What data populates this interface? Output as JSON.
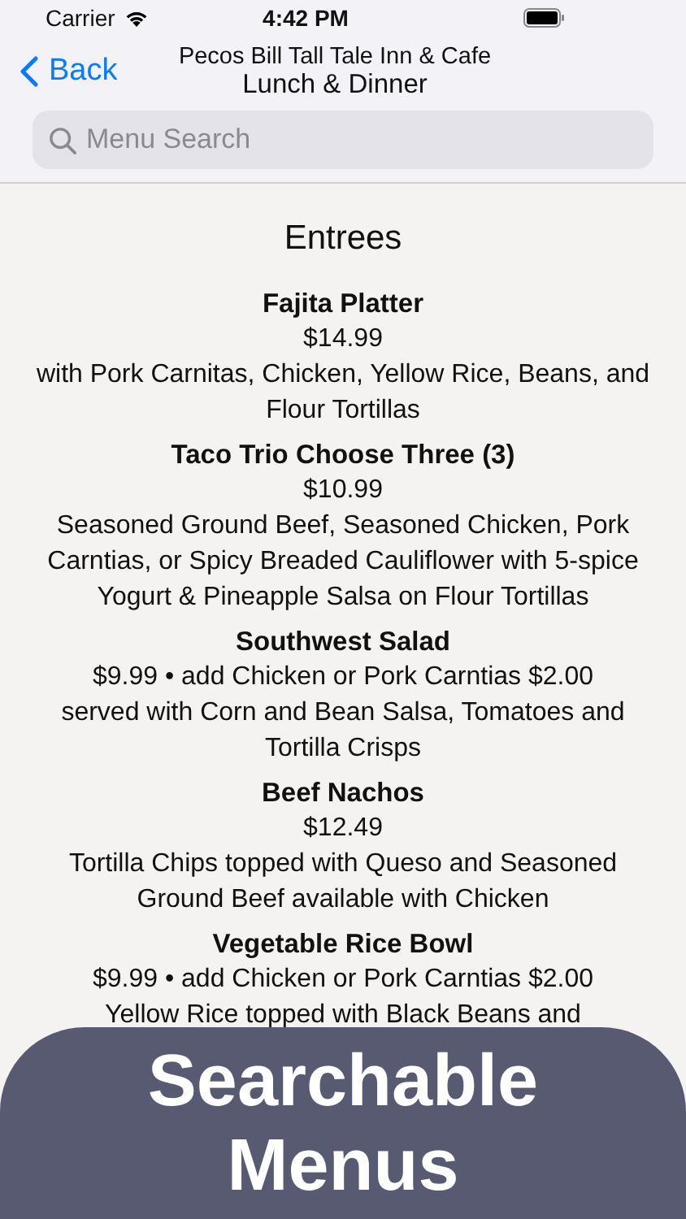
{
  "status_bar": {
    "carrier": "Carrier",
    "time": "4:42 PM"
  },
  "nav": {
    "back": "Back",
    "title": "Pecos Bill Tall Tale Inn & Cafe",
    "subtitle": "Lunch & Dinner"
  },
  "search": {
    "placeholder": "Menu Search"
  },
  "section": {
    "title": "Entrees",
    "items": [
      {
        "name": "Fajita Platter",
        "price": "$14.99",
        "description": "with Pork Carnitas, Chicken, Yellow Rice, Beans, and Flour Tortillas"
      },
      {
        "name": "Taco Trio Choose Three (3)",
        "price": "$10.99",
        "description": "Seasoned Ground Beef, Seasoned Chicken, Pork Carntias,  or Spicy Breaded Cauliflower with 5-spice Yogurt & Pineapple Salsa on Flour Tortillas"
      },
      {
        "name": "Southwest Salad",
        "price": "$9.99 • add Chicken or Pork Carntias $2.00",
        "description": "served with Corn and Bean Salsa, Tomatoes and Tortilla Crisps"
      },
      {
        "name": "Beef Nachos",
        "price": "$12.49",
        "description": "Tortilla Chips topped with Queso and Seasoned Ground Beef available with Chicken"
      },
      {
        "name": "Vegetable Rice Bowl",
        "price": "$9.99 • add Chicken or Pork Carntias $2.00",
        "description": "Yellow Rice topped with Black Beans and"
      }
    ]
  },
  "banner": {
    "text": "Searchable Menus"
  }
}
